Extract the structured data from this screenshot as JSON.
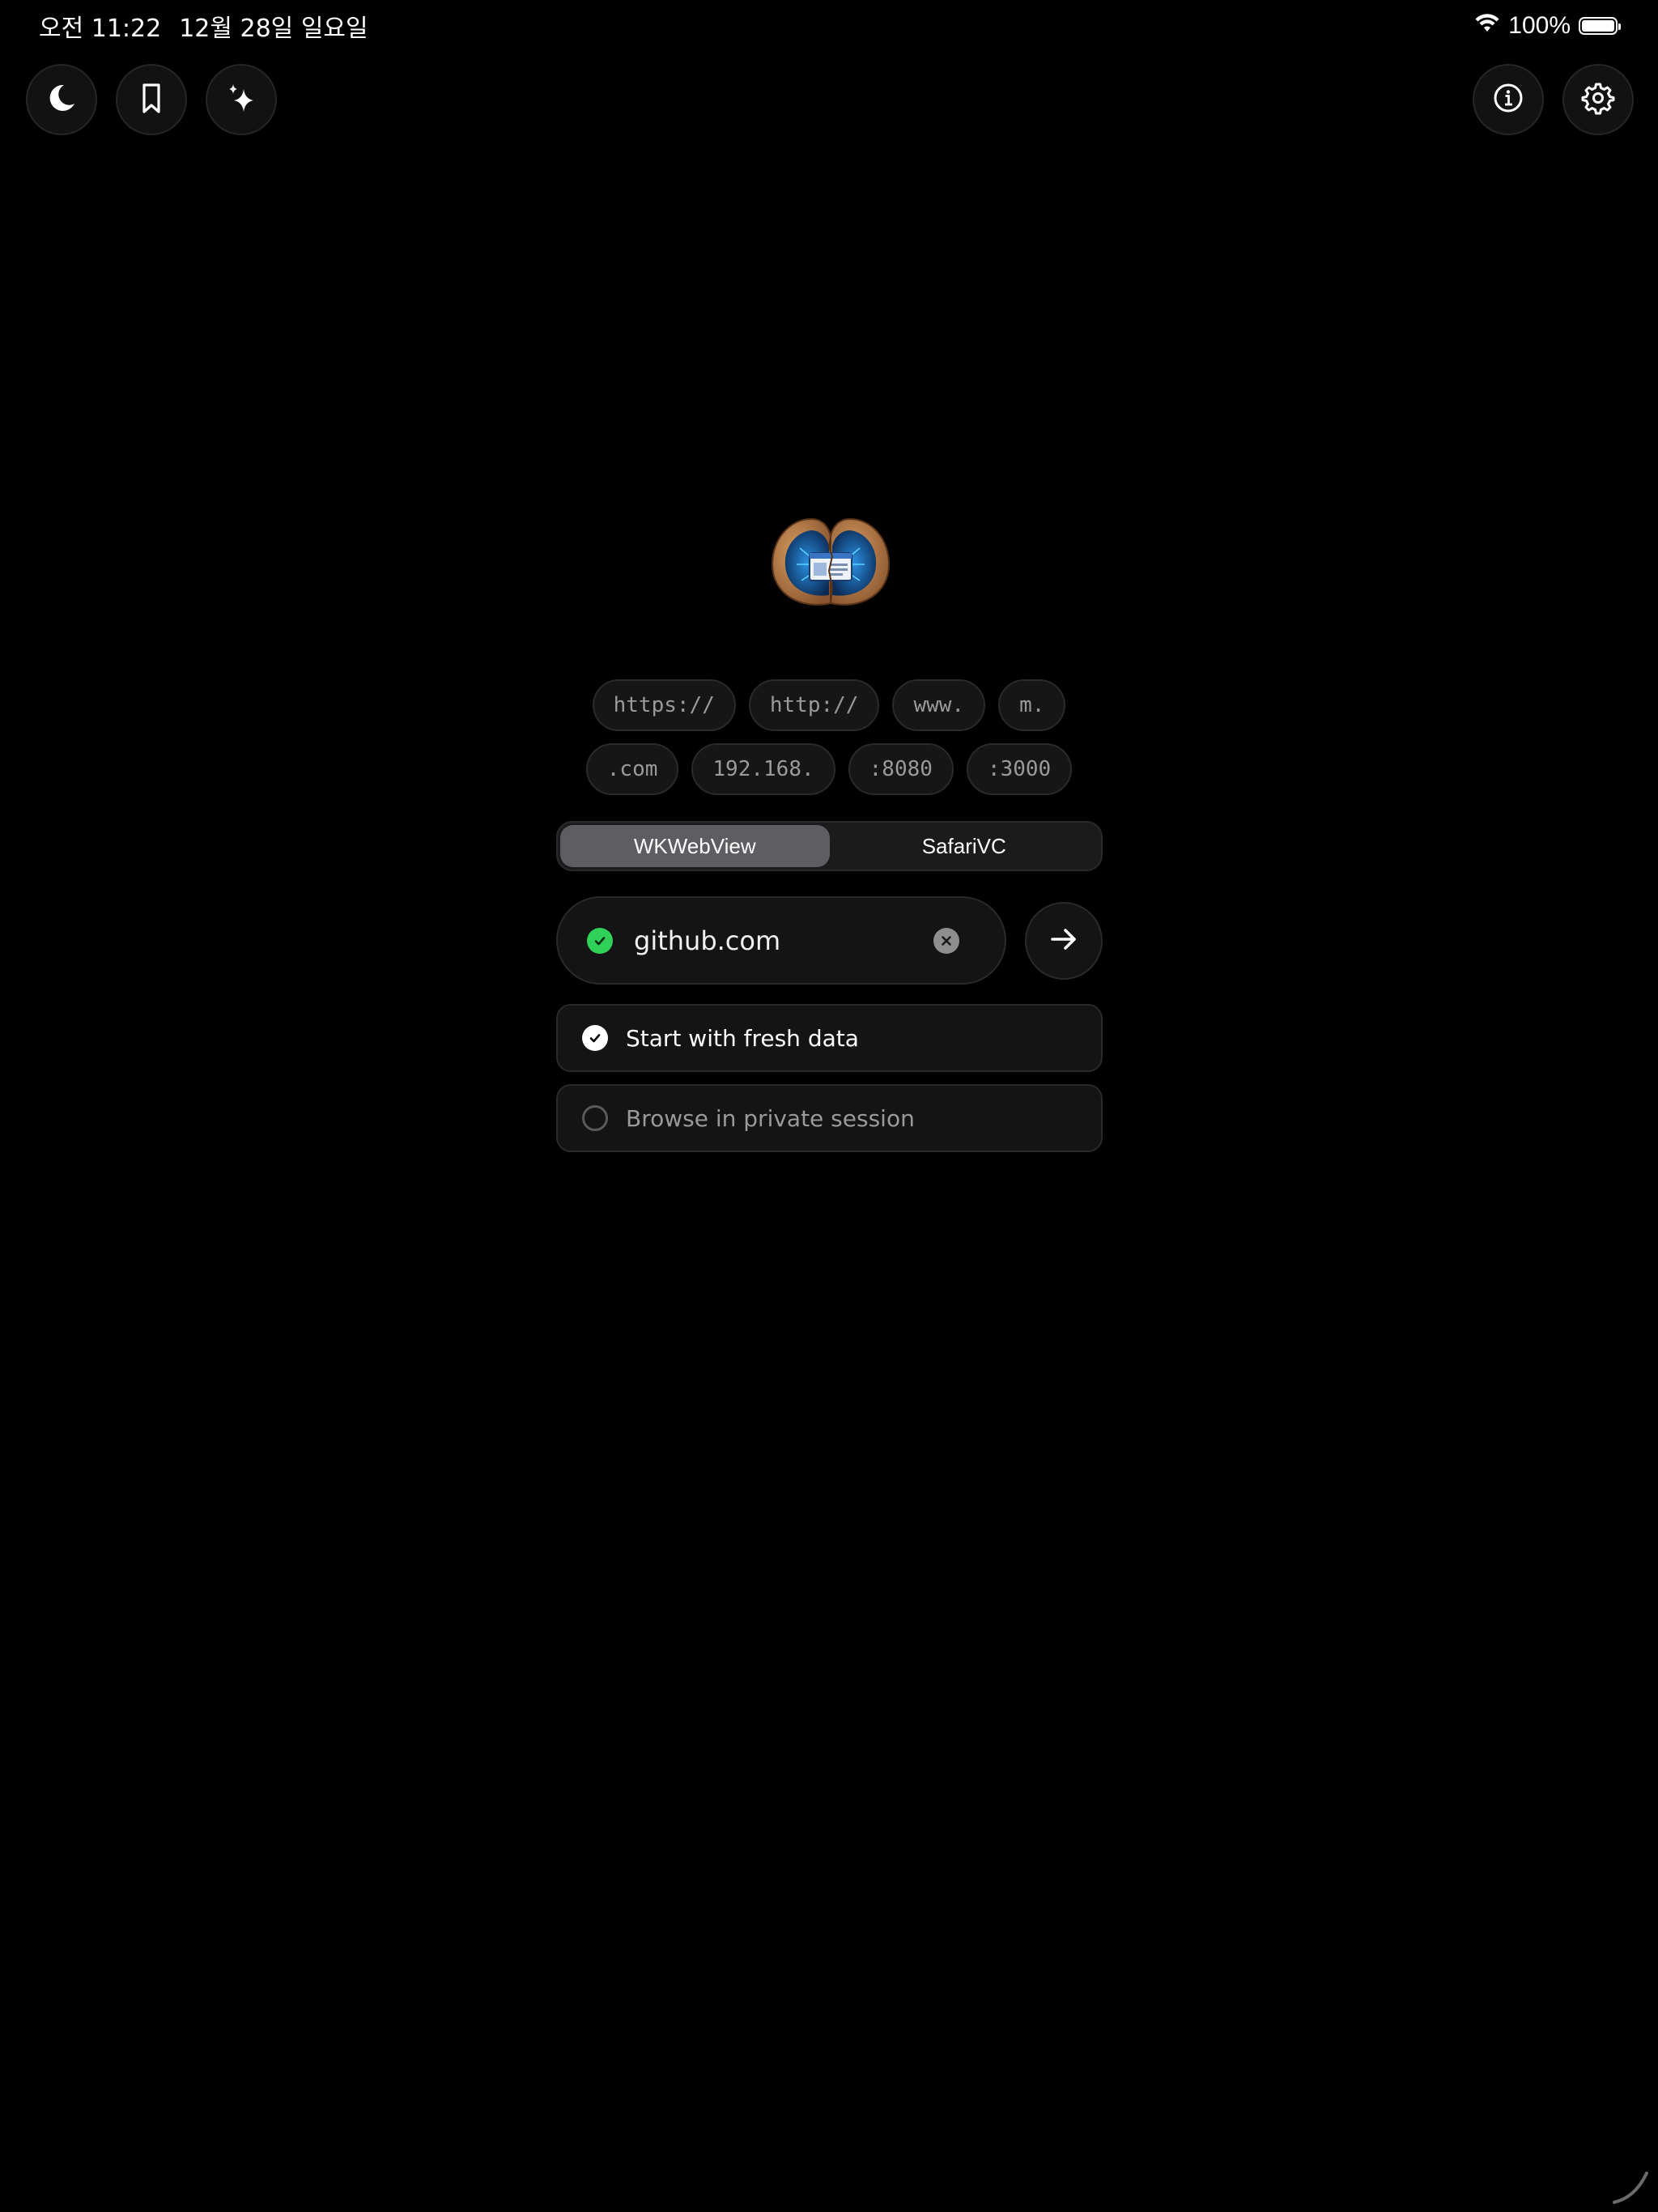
{
  "status_bar": {
    "time": "오전 11:22",
    "date": "12월 28일 일요일",
    "battery_text": "100%",
    "battery_level": 1.0,
    "wifi_icon": "wifi-icon"
  },
  "toolbar_left": [
    {
      "icon": "moon-icon"
    },
    {
      "icon": "bookmark-icon"
    },
    {
      "icon": "sparkles-icon"
    }
  ],
  "toolbar_right": [
    {
      "icon": "info-icon"
    },
    {
      "icon": "gear-icon"
    }
  ],
  "chips": {
    "row1": [
      "https://",
      "http://",
      "www.",
      "m."
    ],
    "row2": [
      ".com",
      "192.168.",
      ":8080",
      ":3000"
    ]
  },
  "segmented": {
    "options": [
      "WKWebView",
      "SafariVC"
    ],
    "selected": "WKWebView"
  },
  "url_input": {
    "value": "github.com",
    "valid": true
  },
  "options": {
    "fresh_data": {
      "label": "Start with fresh data",
      "checked": true
    },
    "private_session": {
      "label": "Browse in private session",
      "checked": false
    }
  },
  "colors": {
    "background": "#000000",
    "valid_green": "#30d158",
    "segment_active": "#5e5e62"
  }
}
